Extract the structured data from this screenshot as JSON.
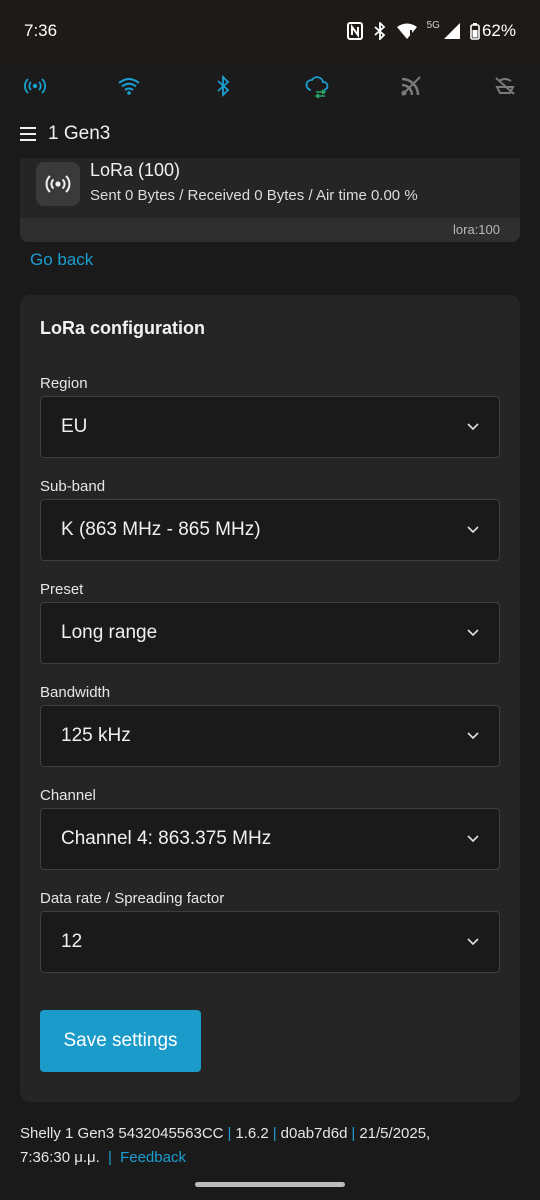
{
  "status_bar": {
    "time": "7:36",
    "network": "5G",
    "battery": "62%",
    "icons": [
      "nfc-icon",
      "bluetooth-icon",
      "wifi-icon",
      "signal-icon",
      "battery-icon"
    ]
  },
  "icon_bar": {
    "icons": [
      "lora-icon",
      "wifi-icon",
      "bluetooth-icon",
      "cloud-sync-icon",
      "rss-icon",
      "ota-icon"
    ],
    "active_color": "#1a9fd0",
    "inactive_color": "#7a7a7a"
  },
  "header": {
    "title": "1 Gen3"
  },
  "device_card": {
    "title": "LoRa (100)",
    "subtitle": "Sent 0 Bytes / Received 0 Bytes / Air time 0.00 %",
    "id": "lora:100"
  },
  "go_back": "Go back",
  "config": {
    "title": "LoRa configuration",
    "fields": [
      {
        "label": "Region",
        "value": "EU"
      },
      {
        "label": "Sub-band",
        "value": "K (863 MHz - 865 MHz)"
      },
      {
        "label": "Preset",
        "value": "Long range"
      },
      {
        "label": "Bandwidth",
        "value": "125 kHz"
      },
      {
        "label": "Channel",
        "value": "Channel 4: 863.375 MHz"
      },
      {
        "label": "Data rate / Spreading factor",
        "value": "12"
      }
    ],
    "save_label": "Save settings"
  },
  "footer": {
    "device": "Shelly 1 Gen3 5432045563CC",
    "version": "1.6.2",
    "build": "d0ab7d6d",
    "datetime": "21/5/2025,",
    "time": "7:36:30 μ.μ.",
    "feedback": "Feedback"
  },
  "colors": {
    "accent": "#1a9fd0",
    "button": "#1b9bc9",
    "card": "#252525",
    "background": "#1a1a1a"
  }
}
